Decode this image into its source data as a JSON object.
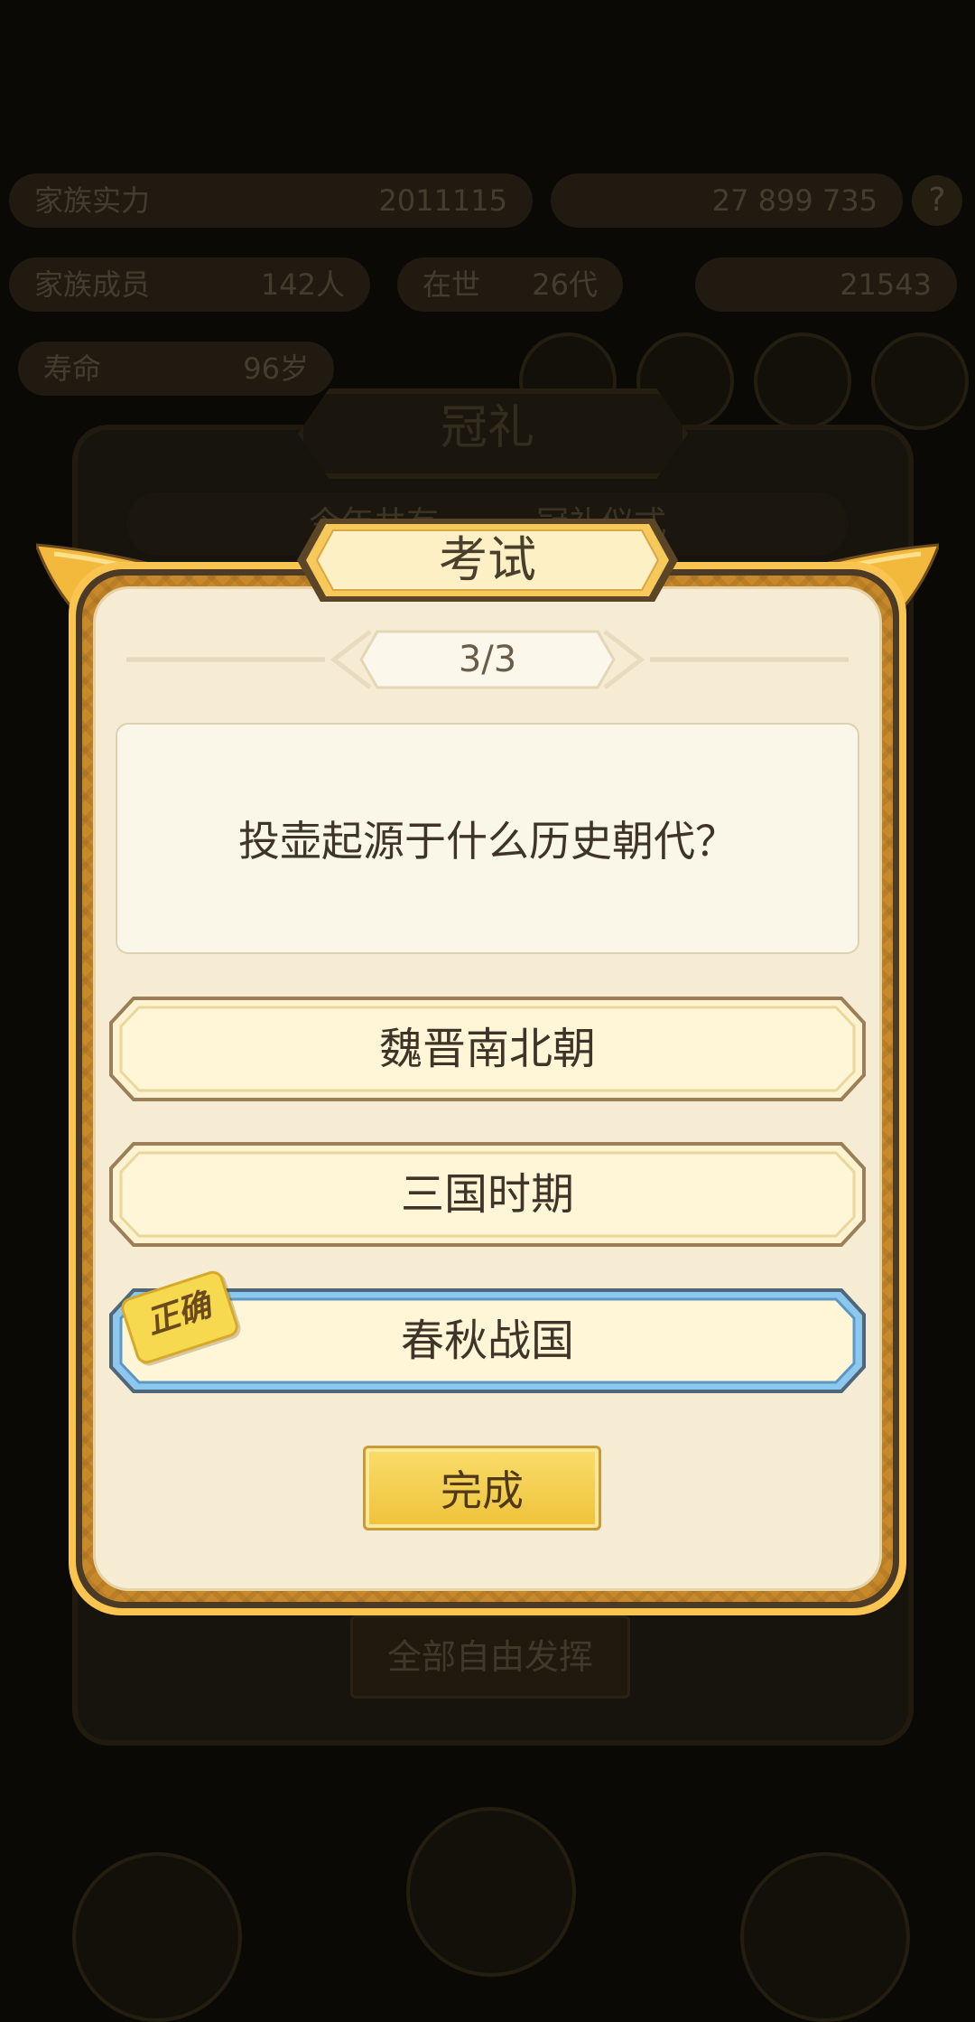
{
  "background": {
    "stats_row1": [
      {
        "label": "家族实力",
        "value": "2011115"
      },
      {
        "label": "",
        "value": "27 899 735"
      }
    ],
    "stats_row2": [
      {
        "label": "家族成员",
        "value": "142人"
      },
      {
        "label": "在世",
        "value": "26代"
      },
      {
        "label": "",
        "value": "21543"
      }
    ],
    "stats_row3": [
      {
        "label": "寿命",
        "value": "96岁"
      }
    ],
    "help_icon": "?",
    "panel_title": "冠礼",
    "panel_subtitle": "今年共有　　　冠礼仪式",
    "free_button_label": "全部自由发挥"
  },
  "dialog": {
    "title": "考试",
    "progress": "3/3",
    "question": "投壶起源于什么历史朝代？",
    "options": [
      {
        "label": "魏晋南北朝",
        "state": "normal"
      },
      {
        "label": "三国时期",
        "state": "normal"
      },
      {
        "label": "春秋战国",
        "state": "correct"
      }
    ],
    "correct_tag": "正确",
    "done_button": "完成"
  },
  "colors": {
    "overlay": "#0a0906",
    "frame_gold": "#f9c450",
    "paper": "#f5ecd3",
    "option_fill": "#fdf3d0",
    "correct_border": "#8cc8ee",
    "correct_tag": "#f6d94e",
    "button_gold": "#efc23a"
  }
}
